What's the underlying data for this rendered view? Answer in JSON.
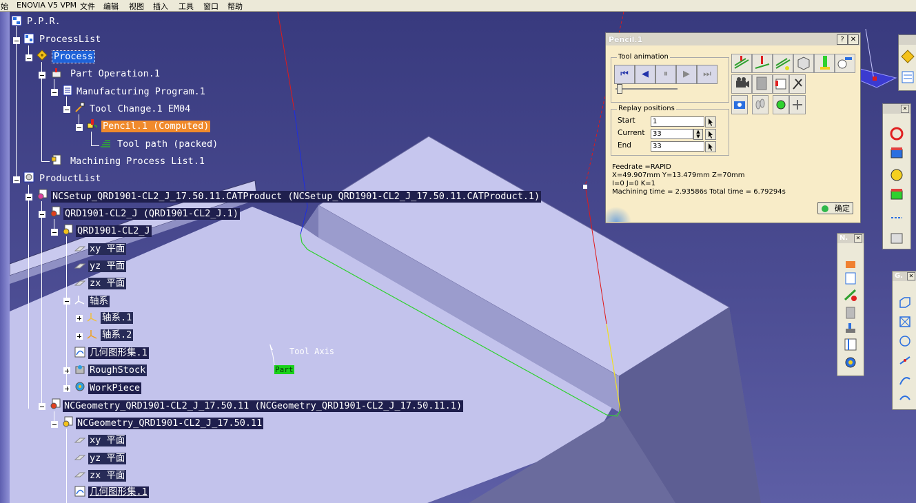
{
  "menubar": {
    "items": [
      "始",
      "ENOVIA V5 VPM",
      "文件",
      "编辑",
      "视图",
      "插入",
      "工具",
      "窗口",
      "帮助"
    ]
  },
  "tree": {
    "root": "P.P.R.",
    "process_list": "ProcessList",
    "process": "Process",
    "part_operation": "Part Operation.1",
    "manufacturing_program": "Manufacturing Program.1",
    "tool_change": "Tool Change.1  EM04",
    "pencil": "Pencil.1 (Computed)",
    "tool_path": "Tool path (packed)",
    "machining_process_list": "Machining Process List.1",
    "product_list": "ProductList",
    "ncsetup": "NCSetup_QRD1901-CL2_J_17.50.11.CATProduct (NCSetup_QRD1901-CL2_J_17.50.11.CATProduct.1)",
    "qrd_instance": "QRD1901-CL2_J (QRD1901-CL2_J.1)",
    "qrd_part": "QRD1901-CL2_J",
    "xy_plane": "xy 平面",
    "yz_plane": "yz 平面",
    "zx_plane": "zx 平面",
    "axis_system": "轴系",
    "axis_system_1": "轴系.1",
    "axis_system_2": "轴系.2",
    "geom_set": "几何图形集.1",
    "rough_stock": "RoughStock",
    "workpiece": "WorkPiece",
    "ncgeometry_instance": "NCGeometry_QRD1901-CL2_J_17.50.11 (NCGeometry_QRD1901-CL2_J_17.50.11.1)",
    "ncgeometry_part": "NCGeometry_QRD1901-CL2_J_17.50.11",
    "xy_plane_2": "xy 平面",
    "yz_plane_2": "yz 平面",
    "zx_plane_2": "zx 平面",
    "geom_set_2": "几何图形集.1"
  },
  "viewport": {
    "tool_axis_label": "Tool Axis",
    "part_label": "Part",
    "colors": {
      "background": "#4a4b8e",
      "part_face": "#c7c7ef",
      "part_side": "#8a8bc0",
      "toolpath": "#2fd12f",
      "tool_axis_red": "#e01a1a",
      "tool_axis_blue": "#1e2ee0",
      "part_tag": "#19d219"
    }
  },
  "dialog": {
    "title": "Pencil.1",
    "help_label": "?",
    "close_label": "✕",
    "tool_animation_label": "Tool animation",
    "anim_buttons": [
      "⏮",
      "◀",
      "⏸",
      "▶",
      "⏭"
    ],
    "replay_label": "Replay positions",
    "start_label": "Start",
    "start_value": "1",
    "current_label": "Current",
    "current_value": "33",
    "end_label": "End",
    "end_value": "33",
    "feedrate_line": "Feedrate =RAPID",
    "position_line": "X=49.907mm Y=13.479mm Z=70mm",
    "ijk_line": "I=0 J=0 K=1",
    "time_line": "Machining time = 2.93586s   Total time = 6.79294s",
    "ok_label": "确定",
    "slider_position": 0.02
  },
  "toolbars": {
    "t1_title": "",
    "t2_title": "",
    "t3_title": "N.",
    "t4_title": "G."
  }
}
